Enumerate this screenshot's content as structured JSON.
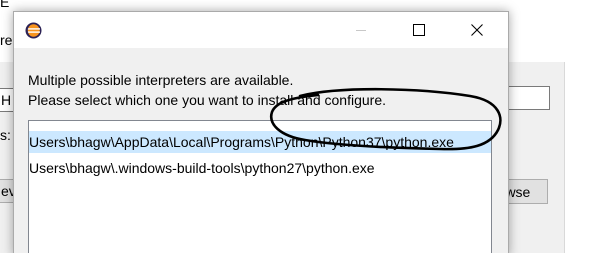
{
  "background": {
    "fragment_top": "E",
    "fragment_label": "re",
    "fragment_field": "H",
    "fragment_colon": "s:",
    "fragment_button_left": "ev",
    "browse_label": "rowse"
  },
  "dialog": {
    "title": "",
    "controls": {
      "minimize": "minimize-icon",
      "maximize": "maximize-icon",
      "close": "close-icon"
    },
    "message_line1": "Multiple possible interpreters are available.",
    "message_line2": "Please select which one you want to install and configure.",
    "interpreters": [
      {
        "path": "Users\\bhagw\\AppData\\Local\\Programs\\Python\\Python37\\python.exe",
        "selected": true
      },
      {
        "path": "Users\\bhagw\\.windows-build-tools\\python27\\python.exe",
        "selected": false
      }
    ]
  },
  "colors": {
    "selection": "#cce8ff",
    "dialog_bg": "#f0f0f0",
    "annotation_stroke": "#000000"
  }
}
